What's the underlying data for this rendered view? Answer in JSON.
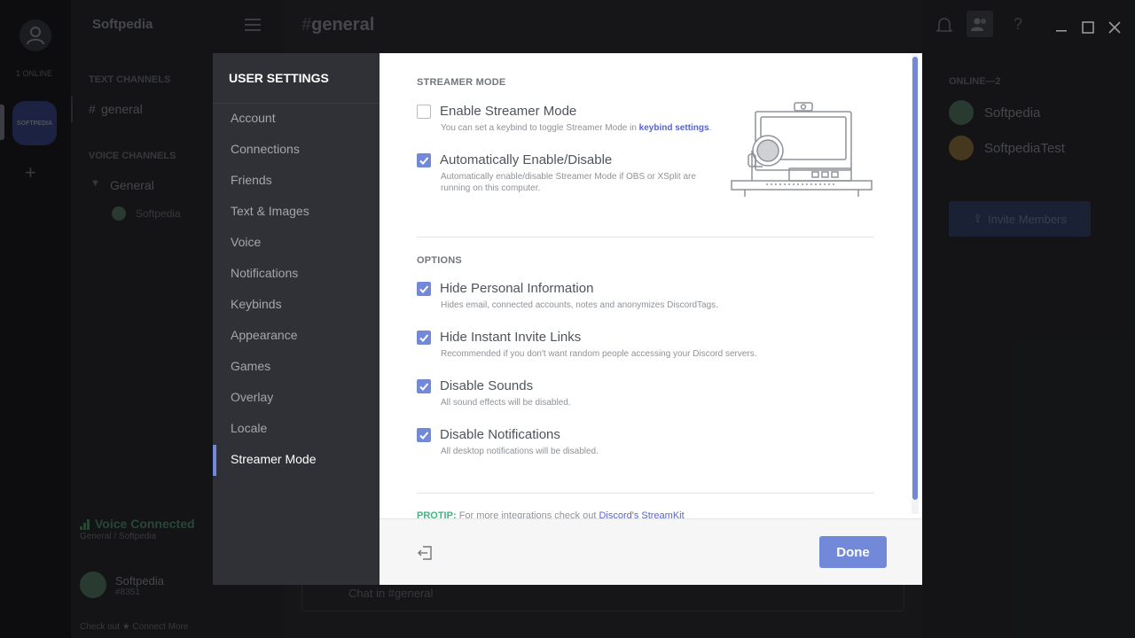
{
  "app": {
    "server_name": "Softpedia",
    "channel_title": "general",
    "online_label": "1 ONLINE",
    "server_icon_label": "SOFTPEDIA",
    "text_channels_header": "TEXT CHANNELS",
    "text_channel": "general",
    "voice_channels_header": "VOICE CHANNELS",
    "voice_channel": "General",
    "voice_user": "Softpedia",
    "voice_connected": "Voice Connected",
    "voice_location": "General / Softpedia",
    "user_name": "Softpedia",
    "user_tag": "#8351",
    "bottom_text": "Check out ★ Connect More",
    "members_header": "ONLINE—2",
    "members": [
      "Softpedia",
      "SoftpediaTest"
    ],
    "invite_button": "Invite Members",
    "chat_placeholder": "Chat in #general"
  },
  "settings": {
    "title": "USER SETTINGS",
    "nav": [
      {
        "label": "Account"
      },
      {
        "label": "Connections"
      },
      {
        "label": "Friends"
      },
      {
        "label": "Text & Images"
      },
      {
        "label": "Voice"
      },
      {
        "label": "Notifications"
      },
      {
        "label": "Keybinds"
      },
      {
        "label": "Appearance"
      },
      {
        "label": "Games"
      },
      {
        "label": "Overlay"
      },
      {
        "label": "Locale"
      },
      {
        "label": "Streamer Mode"
      }
    ],
    "active_item": "Streamer Mode"
  },
  "streamer": {
    "section_title": "STREAMER MODE",
    "enable_label": "Enable Streamer Mode",
    "enable_checked": false,
    "enable_desc": "You can set a keybind to toggle Streamer Mode in",
    "enable_desc_link": "keybind settings",
    "auto_label": "Automatically Enable/Disable",
    "auto_checked": true,
    "auto_desc_line1": "Automatically enable/disable Streamer Mode if OBS or XSplit are",
    "auto_desc_line2": "running on this computer.",
    "options_title": "OPTIONS",
    "options": [
      {
        "label": "Hide Personal Information",
        "desc": "Hides email, connected accounts, notes and anonymizes DiscordTags.",
        "checked": true
      },
      {
        "label": "Hide Instant Invite Links",
        "desc": "Recommended if you don't want random people accessing your Discord servers.",
        "checked": true
      },
      {
        "label": "Disable Sounds",
        "desc": "All sound effects will be disabled.",
        "checked": true
      },
      {
        "label": "Disable Notifications",
        "desc": "All desktop notifications will be disabled.",
        "checked": true
      }
    ],
    "protip_label": "PROTIP:",
    "protip_text": "For more integrations check out",
    "protip_link": "Discord's StreamKit"
  },
  "footer": {
    "done_label": "Done"
  },
  "colors": {
    "accent": "#7289da",
    "protip": "#43b581"
  }
}
